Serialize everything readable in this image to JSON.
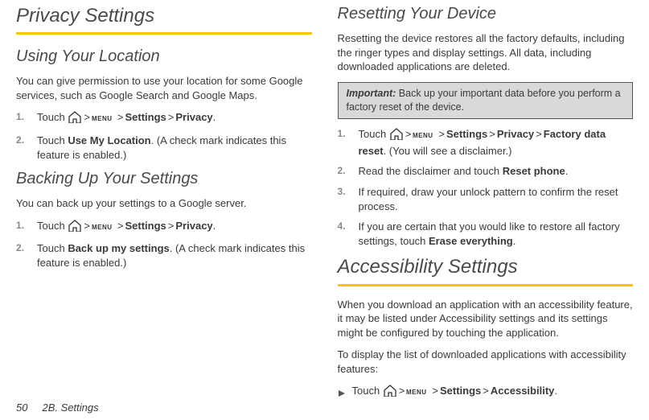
{
  "left": {
    "h1": "Privacy Settings",
    "h2a": "Using Your Location",
    "p1": "You can give permission to use your location for some Google services, such as Google Search and Google Maps.",
    "steps_a": {
      "s1_pre": "Touch ",
      "s1_settings": "Settings",
      "s1_privacy": "Privacy",
      "s1_post": ".",
      "s2_pre": "Touch ",
      "s2_bold": "Use My Location",
      "s2_post": ". (A check mark indicates this feature is enabled.)"
    },
    "h2b": "Backing Up Your Settings",
    "p2": "You can back up your settings to a Google server.",
    "steps_b": {
      "s1_pre": "Touch ",
      "s1_settings": "Settings",
      "s1_privacy": "Privacy",
      "s1_post": ".",
      "s2_pre": "Touch ",
      "s2_bold": "Back up my settings",
      "s2_post": ". (A check mark indicates this feature is enabled.)"
    }
  },
  "right": {
    "h2a": "Resetting Your Device",
    "p1": "Resetting the device restores all the factory defaults, including the ringer types and display settings. All data, including downloaded applications are deleted.",
    "callout_label": "Important:",
    "callout_text": " Back up your important data before you perform a factory reset of the device.",
    "steps_a": {
      "s1_pre": "Touch ",
      "s1_settings": "Settings",
      "s1_privacy": "Privacy",
      "s1_factory": "Factory data reset",
      "s1_post": ". (You will see a disclaimer.)",
      "s2_pre": "Read the disclaimer and touch ",
      "s2_bold": "Reset phone",
      "s2_post": ".",
      "s3": "If required, draw your unlock pattern to confirm the reset process.",
      "s4_pre": "If you are certain that you would like to restore all factory settings, touch ",
      "s4_bold": "Erase everything",
      "s4_post": "."
    },
    "h1b": "Accessibility Settings",
    "p2": "When you download an application with an accessibility feature, it may be listed under Accessibility settings and its settings might be configured by touching the application.",
    "p3": "To display the list of downloaded applications with accessibility features:",
    "bullet": {
      "pre": "Touch ",
      "settings": "Settings",
      "accessibility": "Accessibility",
      "post": "."
    }
  },
  "footer": {
    "page": "50",
    "section": "2B. Settings"
  },
  "glyphs": {
    "gt": ">"
  }
}
